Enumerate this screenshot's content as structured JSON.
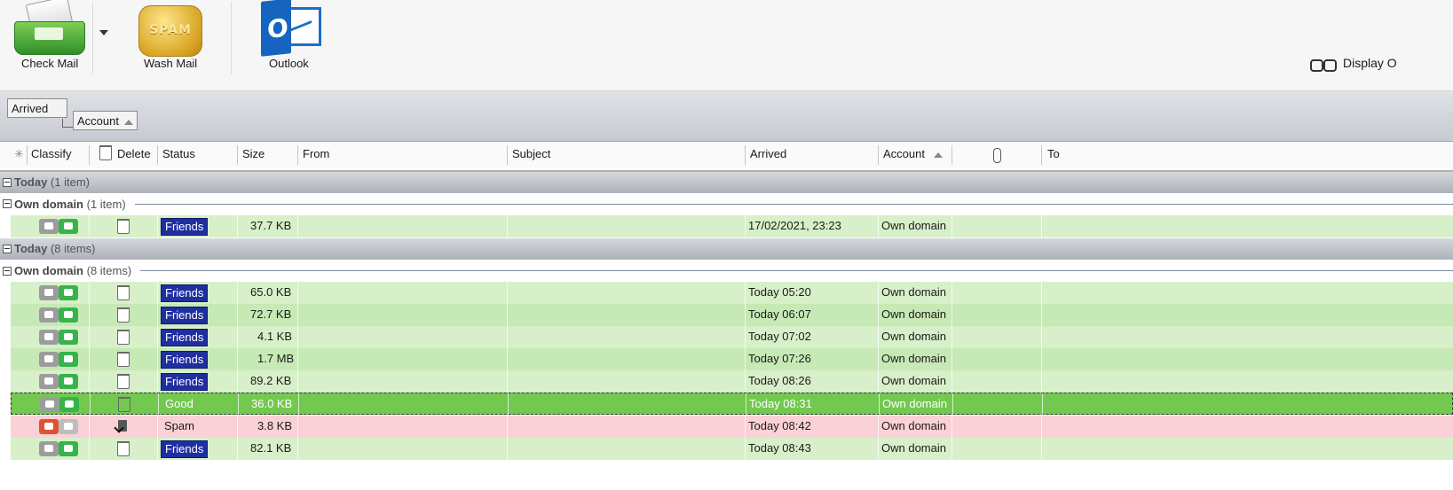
{
  "toolbar": {
    "check_mail": "Check Mail",
    "wash_mail": "Wash Mail",
    "spam_icon_text": "SPAM",
    "outlook": "Outlook",
    "outlook_icon_letter": "O",
    "display_options": "Display O"
  },
  "groupby": {
    "level1": "Arrived",
    "level2": "Account"
  },
  "columns": {
    "classify": "Classify",
    "delete": "Delete",
    "status": "Status",
    "size": "Size",
    "from": "From",
    "subject": "Subject",
    "arrived": "Arrived",
    "account": "Account",
    "to": "To"
  },
  "groups": [
    {
      "day_label": "Today",
      "day_count": "(1 item)",
      "domain_label": "Own domain",
      "domain_count": "(1 item)",
      "rows": [
        {
          "status": "Friends",
          "size": "37.7 KB",
          "from": "",
          "subject": "",
          "arrived": "17/02/2021, 23:23",
          "account": "Own domain",
          "to": ""
        }
      ]
    },
    {
      "day_label": "Today",
      "day_count": "(8 items)",
      "domain_label": "Own domain",
      "domain_count": "(8 items)",
      "rows": [
        {
          "status": "Friends",
          "size": "65.0 KB",
          "from": "",
          "subject": "",
          "arrived": "Today 05:20",
          "account": "Own domain",
          "to": ""
        },
        {
          "status": "Friends",
          "size": "72.7 KB",
          "from": "",
          "subject": "",
          "arrived": "Today 06:07",
          "account": "Own domain",
          "to": ""
        },
        {
          "status": "Friends",
          "size": "4.1 KB",
          "from": "",
          "subject": "",
          "arrived": "Today 07:02",
          "account": "Own domain",
          "to": ""
        },
        {
          "status": "Friends",
          "size": "1.7 MB",
          "from": "",
          "subject": "",
          "arrived": "Today 07:26",
          "account": "Own domain",
          "to": ""
        },
        {
          "status": "Friends",
          "size": "89.2 KB",
          "from": "",
          "subject": "",
          "arrived": "Today 08:26",
          "account": "Own domain",
          "to": ""
        },
        {
          "status": "Good",
          "size": "36.0 KB",
          "from": "",
          "subject": "",
          "arrived": "Today 08:31",
          "account": "Own domain",
          "to": ""
        },
        {
          "status": "Spam",
          "size": "3.8 KB",
          "from": "",
          "subject": "",
          "arrived": "Today 08:42",
          "account": "Own domain",
          "to": ""
        },
        {
          "status": "Friends",
          "size": "82.1 KB",
          "from": "",
          "subject": "",
          "arrived": "Today 08:43",
          "account": "Own domain",
          "to": ""
        }
      ]
    }
  ],
  "colors": {
    "friends_row": "#d7f0c9",
    "good_row": "#73c84f",
    "spam_row": "#fad1d6",
    "friends_badge": "#1f2fa0"
  },
  "icons": {
    "check_mail": "inbox-tray-icon",
    "wash_mail": "spam-soap-icon",
    "outlook": "outlook-icon",
    "display": "glasses-icon",
    "classify": "thumbs-vote-icon",
    "delete": "trash-icon",
    "attachment": "paperclip-icon"
  }
}
